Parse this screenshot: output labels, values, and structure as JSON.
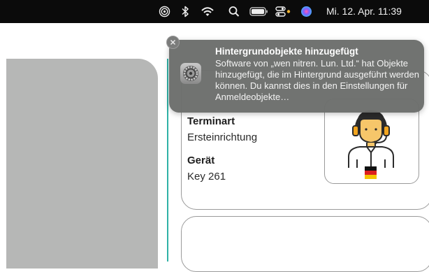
{
  "menubar": {
    "date_time": "Mi. 12. Apr. 11:39",
    "icons": [
      "airdrop-icon",
      "bluetooth-icon",
      "wifi-icon",
      "search-icon",
      "battery-icon",
      "control-center-icon",
      "siri-icon"
    ],
    "colors": {
      "background": "#0b0b0b",
      "siri": "#6b8cff",
      "dot": "#f2b632"
    }
  },
  "notification": {
    "title": "Hintergrundobjekte hinzugefügt",
    "body": "Software von „wen nitren. Lun. Ltd.“ hat Objekte hinzugefügt, die im Hintergrund ausgeführt werden können. Du kannst dies in den Einstellungen für Anmeldeobjekte…",
    "icon": "settings-gear-icon",
    "close_icon": "close-icon"
  },
  "card": {
    "terminal_label": "Terminart",
    "terminal_value": "Ersteinrichtung",
    "device_label": "Gerät",
    "device_value": "Key 261",
    "avatar": "support-agent-icon",
    "flag": "germany-flag-icon"
  },
  "colors": {
    "left_panel": "#b6b7b6",
    "teal_line": "#2fb2a6",
    "card_border": "#9a9a9a"
  }
}
